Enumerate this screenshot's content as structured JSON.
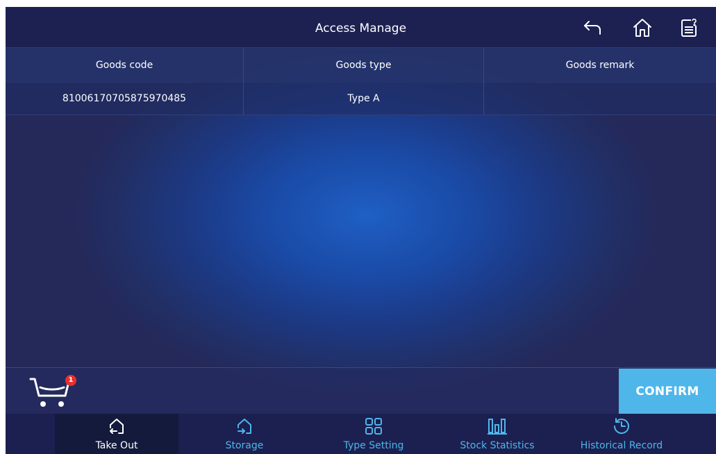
{
  "header": {
    "title": "Access Manage"
  },
  "table": {
    "columns": [
      "Goods code",
      "Goods type",
      "Goods remark"
    ],
    "rows": [
      {
        "code": "81006170705875970485",
        "type": "Type A",
        "remark": ""
      }
    ]
  },
  "cart": {
    "count": "1"
  },
  "confirm_label": "CONFIRM",
  "nav": [
    {
      "label": "Take Out",
      "icon": "take-out-icon"
    },
    {
      "label": "Storage",
      "icon": "storage-icon"
    },
    {
      "label": "Type Setting",
      "icon": "grid-icon"
    },
    {
      "label": "Stock Statistics",
      "icon": "bar-chart-icon"
    },
    {
      "label": "Historical Record",
      "icon": "history-icon"
    }
  ],
  "colors": {
    "accent": "#4fb6ea",
    "badge": "#e8302e",
    "topbar": "#1c2152"
  }
}
